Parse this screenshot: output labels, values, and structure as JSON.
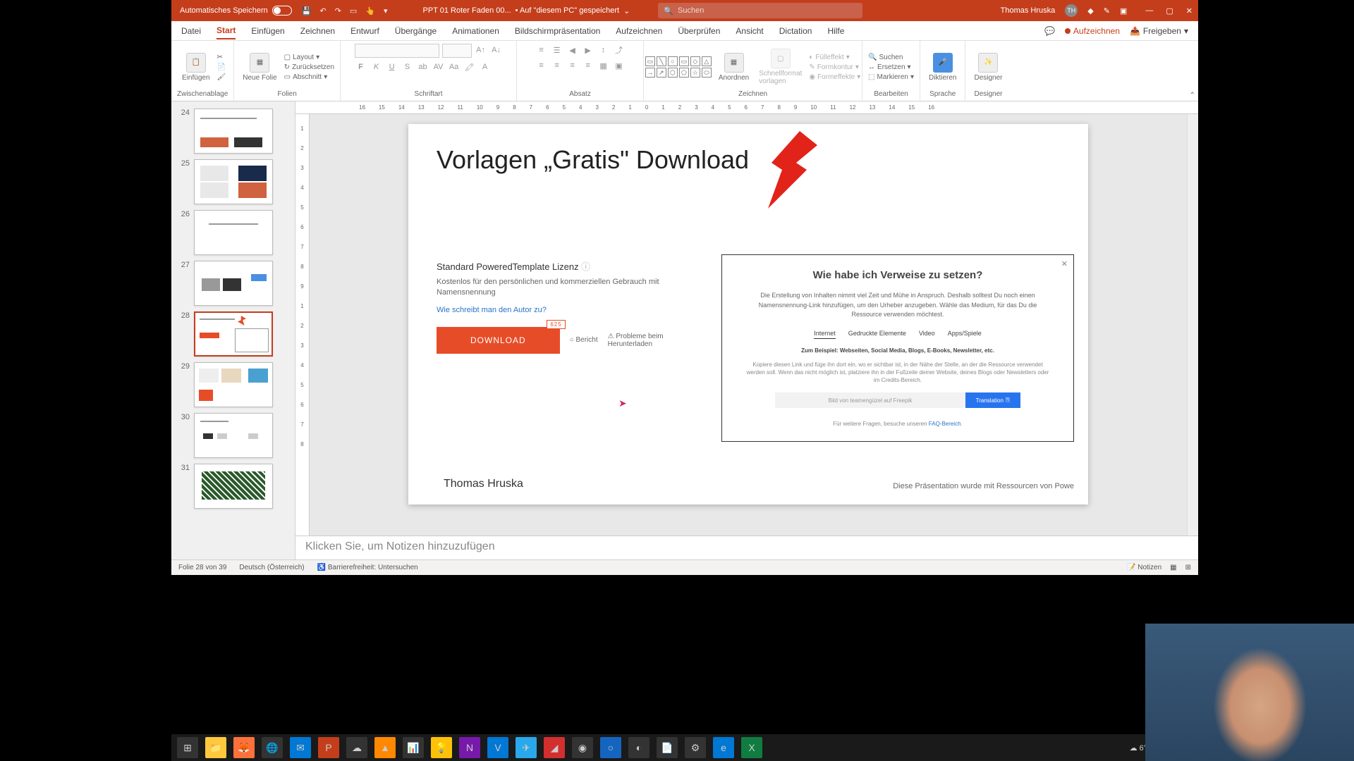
{
  "titlebar": {
    "autosave_label": "Automatisches Speichern",
    "doc_name": "PPT 01 Roter Faden 00...",
    "saved_loc": "• Auf \"diesem PC\" gespeichert",
    "search_placeholder": "Suchen",
    "user_name": "Thomas Hruska",
    "user_initials": "TH"
  },
  "tabs": {
    "items": [
      "Datei",
      "Start",
      "Einfügen",
      "Zeichnen",
      "Entwurf",
      "Übergänge",
      "Animationen",
      "Bildschirmpräsentation",
      "Aufzeichnen",
      "Überprüfen",
      "Ansicht",
      "Dictation",
      "Hilfe"
    ],
    "active": "Start",
    "record": "Aufzeichnen",
    "share": "Freigeben"
  },
  "ribbon": {
    "paste": "Einfügen",
    "clipboard": "Zwischenablage",
    "new_slide": "Neue Folie",
    "layout": "Layout",
    "reset": "Zurücksetzen",
    "section": "Abschnitt",
    "slides": "Folien",
    "font": "Schriftart",
    "paragraph": "Absatz",
    "arrange": "Anordnen",
    "quickfmt": "Schnellformat vorlagen",
    "fill": "Fülleffekt",
    "outline": "Formkontur",
    "effects": "Formeffekte",
    "drawing": "Zeichnen",
    "find": "Suchen",
    "replace": "Ersetzen",
    "select": "Markieren",
    "editing": "Bearbeiten",
    "dictate": "Diktieren",
    "language": "Sprache",
    "designer": "Designer",
    "designer_grp": "Designer"
  },
  "ruler_h": [
    "16",
    "15",
    "14",
    "13",
    "12",
    "11",
    "10",
    "9",
    "8",
    "7",
    "6",
    "5",
    "4",
    "3",
    "2",
    "1",
    "0",
    "1",
    "2",
    "3",
    "4",
    "5",
    "6",
    "7",
    "8",
    "9",
    "10",
    "11",
    "12",
    "13",
    "14",
    "15",
    "16"
  ],
  "ruler_v": [
    "1",
    "2",
    "3",
    "4",
    "5",
    "6",
    "7",
    "8",
    "9",
    "1",
    "2",
    "3",
    "4",
    "5",
    "6",
    "7",
    "8"
  ],
  "thumbs": [
    {
      "n": "24"
    },
    {
      "n": "25"
    },
    {
      "n": "26"
    },
    {
      "n": "27"
    },
    {
      "n": "28",
      "sel": true
    },
    {
      "n": "29"
    },
    {
      "n": "30"
    },
    {
      "n": "31"
    }
  ],
  "slide": {
    "title": "Vorlagen „Gratis\" Download",
    "lic_title": "Standard PoweredTemplate Lizenz",
    "lic_desc": "Kostenlos für den persönlichen und kommerziellen Gebrauch mit Namensnennung",
    "lic_link": "Wie schreibt man den Autor zu?",
    "download": "DOWNLOAD",
    "bericht": "Bericht",
    "problems": "Probleme beim Herunterladen",
    "ref_title": "Wie habe ich Verweise zu setzen?",
    "ref_text": "Die Erstellung von Inhalten nimmt viel Zeit und Mühe in Anspruch. Deshalb solltest Du noch einen Namensnennung-Link hinzufügen, um den Urheber anzugeben. Wähle das Medium, für das Du die Ressource verwenden möchtest.",
    "ref_tabs": [
      "Internet",
      "Gedruckte Elemente",
      "Video",
      "Apps/Spiele"
    ],
    "ref_example": "Zum Beispiel: Webseiten, Social Media, Blogs, E-Books, Newsletter, etc.",
    "ref_small": "Kopiere diesen Link und füge ihn dort ein, wo er sichtbar ist, in der Nähe der Stelle, an der die Ressource verwendet werden soll. Wenn das nicht möglich ist, platziere ihn in der Fußzeile deiner Website, deines Blogs oder Newsletters oder im Credits-Bereich.",
    "ref_input": "Bild von teamengüzel auf Freepik",
    "ref_copy": "Translation",
    "ref_faq_pre": "Für weitere Fragen, besuche unseren ",
    "ref_faq_link": "FAQ-Bereich",
    "author": "Thomas Hruska",
    "attribution": "Diese Präsentation wurde mit Ressourcen von Powe"
  },
  "notes": "Klicken Sie, um Notizen hinzuzufügen",
  "status": {
    "slide_of": "Folie 28 von 39",
    "lang": "Deutsch (Österreich)",
    "access": "Barrierefreiheit: Untersuchen",
    "notes_btn": "Notizen"
  },
  "taskbar": {
    "temp": "6°C"
  }
}
